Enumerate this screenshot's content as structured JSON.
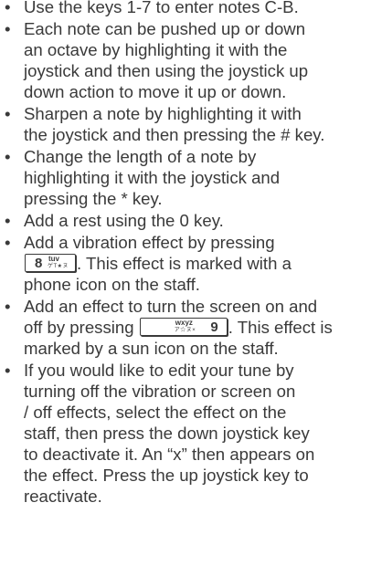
{
  "bullet_symbol": "•",
  "lines": {
    "b1_l1": "Use the keys 1-7 to enter notes C-B.",
    "b2_l1": "Each note can be pushed up or down",
    "b2_l2": "an octave by highlighting it with the",
    "b2_l3": "joystick and then using the joystick up",
    "b2_l4": "down action to move it up or down.",
    "b3_l1": "Sharpen a note by highlighting it with",
    "b3_l2": "the joystick and then pressing the # key.",
    "b4_l1": "Change the length of a note by",
    "b4_l2": "highlighting it with the joystick and",
    "b4_l3": "pressing the * key.",
    "b5_l1": "Add a rest using the 0 key.",
    "b6_l1": "Add a vibration effect by pressing",
    "b6_l2_after": ". This effect is marked with a",
    "b6_l3": "phone icon on the staff.",
    "b7_l1": "Add an effect to turn the screen on and",
    "b7_l2_before": "off by pressing",
    "b7_l2_after": ". This effect is",
    "b7_l3": "marked by a sun icon on the staff.",
    "b8_l1": "If you would like to edit your tune by",
    "b8_l2": "turning off the vibration or screen on",
    "b8_l3": "/ off effects, select the effect on the",
    "b8_l4": "staff, then press the down joystick key",
    "b8_l5": "to deactivate it. An “x” then appears on",
    "b8_l6": "the effect. Press the up joystick key to",
    "b8_l7": "reactivate."
  },
  "keys": {
    "key8": {
      "number": "8",
      "letters": "tuv",
      "kana": "ゲT★ヌ"
    },
    "key9": {
      "number": "9",
      "letters": "wxyz",
      "kana": "ア☆ヌ×"
    }
  }
}
